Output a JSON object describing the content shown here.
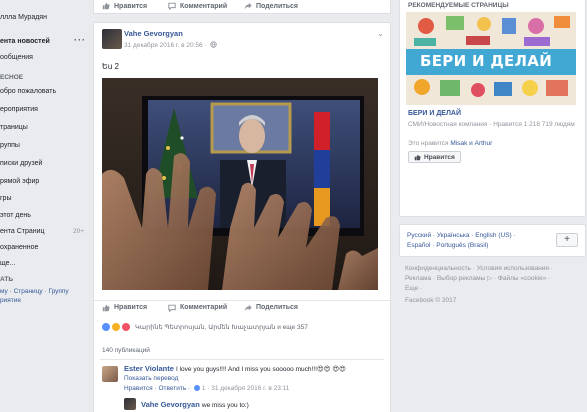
{
  "left_nav": {
    "profile_name": "ллла Мурадян",
    "news_feed": "ента новостей",
    "messages": "ообщения",
    "explore_header": "ЕСНОЕ",
    "items": [
      "обро пожаловать",
      "ероприятия",
      "траницы",
      "руппы",
      "писки друзей",
      "рямой эфир",
      "гры",
      "этот день",
      "ента Страниц",
      "охраненное",
      "ще..."
    ],
    "pages_feed_count": "20+",
    "create_header": "АТЬ",
    "create_links": "му · Страницу · Группу",
    "create_links2": "риятие"
  },
  "top_actions": {
    "like": "Нравится",
    "comment": "Комментарий",
    "share": "Поделиться"
  },
  "post": {
    "author": "Vahe Gevorgyan",
    "meta": "31 декабря 2016 г. в 20:56 ·",
    "text": "Եu 2",
    "actions": {
      "like": "Нравится",
      "comment": "Комментарий",
      "share": "Поделиться"
    },
    "reactions_text": "Կարինե Պետրոսյան, Արմեն Խաչատրյան и еще 357",
    "shares": "140 публикаций",
    "comments": [
      {
        "name": "Ester Violante",
        "text": "I love you guys!!!! And I miss you sooooo much!!!😍😍 😍😍",
        "translate": "Показать перевод",
        "actions": "Нравится · Ответить ·",
        "like_count": "1",
        "time": "· 31 декабря 2016 г. в 23:11"
      },
      {
        "name": "Vahe Gevorgyan",
        "text": "we miss you to:)"
      }
    ]
  },
  "right": {
    "suggested_title": "РЕКОМЕНДУЕМЫЕ СТРАНИЦЫ",
    "banner_text": "БЕРИ И ДЕЛАЙ",
    "page_name": "БЕРИ И ДЕЛАЙ",
    "page_desc": "СМИ/Новостная компания · Нравится 1 218 719 людям",
    "liked_prefix": "Это нравится ",
    "liked_names": "Misak и Arthur",
    "like_button": "Нравится",
    "languages_line1": "Русский · Українська · English (US) ·",
    "languages_line2": "Español · Português (Brasil)",
    "plus_label": "+",
    "footer_line1": "Конфиденциальность · Условия использования ·",
    "footer_line2": "Реклама · Выбор рекламы ▷ · Файлы «cookie» ·",
    "footer_line3": "Еще ·",
    "footer_copy": "Facebook © 2017"
  },
  "colors": {
    "link": "#365899",
    "bg": "#e9ebee",
    "banner_blue": "#41a8d4"
  }
}
